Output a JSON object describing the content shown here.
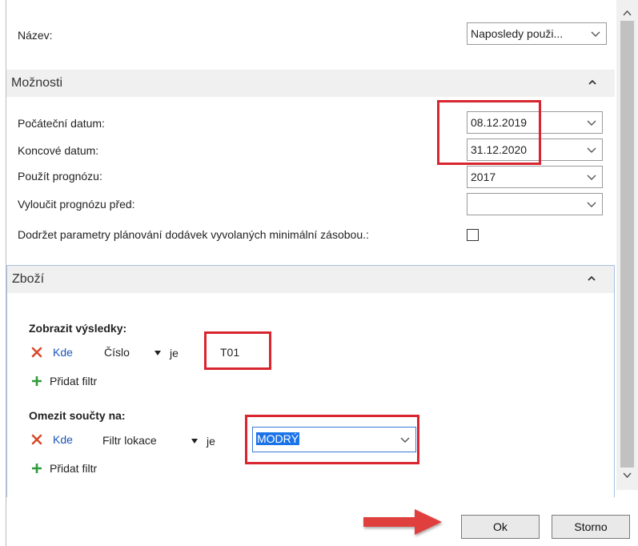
{
  "nazev": {
    "label": "Název:",
    "value": "Naposledy použi..."
  },
  "moznosti": {
    "title": "Možnosti",
    "start_date": {
      "label": "Počáteční datum:",
      "value": "08.12.2019"
    },
    "end_date": {
      "label": "Koncové datum:",
      "value": "31.12.2020"
    },
    "forecast": {
      "label": "Použít prognózu:",
      "value": "2017"
    },
    "exclude_forecast": {
      "label": "Vyloučit prognózu před:",
      "value": ""
    },
    "respect_params": {
      "label": "Dodržet parametry plánování dodávek vyvolaných minimální zásobou.:"
    }
  },
  "zbozi": {
    "title": "Zboží",
    "show_results": {
      "heading": "Zobrazit výsledky:",
      "where": "Kde",
      "field": "Číslo",
      "op": "je",
      "value": "T01",
      "add_filter": "Přidat filtr"
    },
    "limit_totals": {
      "heading": "Omezit součty na:",
      "where": "Kde",
      "field": "Filtr lokace",
      "op": "je",
      "value": "MODRÝ",
      "add_filter": "Přidat filtr"
    }
  },
  "buttons": {
    "ok": "Ok",
    "cancel": "Storno"
  },
  "colors": {
    "highlight": "#d8252f",
    "link": "#1a55b8",
    "arrow": "#e0413c",
    "add": "#2e9b3a"
  }
}
